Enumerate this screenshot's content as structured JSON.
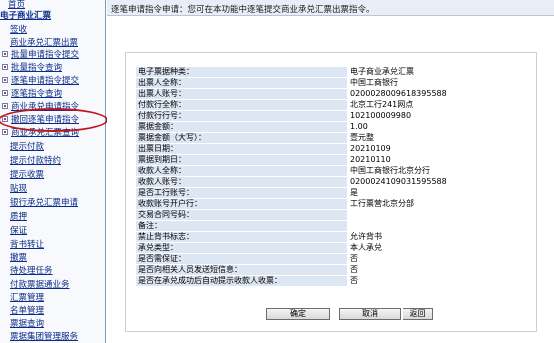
{
  "sidebar": {
    "items": [
      {
        "label": "首页",
        "kind": "plain"
      },
      {
        "label": "电子商业汇票",
        "kind": "section"
      },
      {
        "label": "签收",
        "kind": "plain"
      },
      {
        "label": "商业承兑汇票出票",
        "kind": "plain"
      },
      {
        "label": "批量申请指令提交",
        "kind": "bullet"
      },
      {
        "label": "批量指令查询",
        "kind": "bullet"
      },
      {
        "label": "逐笔申请指令提交",
        "kind": "bullet"
      },
      {
        "label": "逐笔指令查询",
        "kind": "bullet"
      },
      {
        "label": "商业承兑申请指令",
        "kind": "bullet"
      },
      {
        "label": "撤回逐笔申请指令",
        "kind": "bullet"
      },
      {
        "label": "商业承兑汇票查询",
        "kind": "bullet"
      },
      {
        "label": "提示付款",
        "kind": "plain"
      },
      {
        "label": "提示付款特约",
        "kind": "plain"
      },
      {
        "label": "提示收票",
        "kind": "plain"
      },
      {
        "label": "贴现",
        "kind": "plain"
      },
      {
        "label": "银行承兑汇票申请",
        "kind": "plain"
      },
      {
        "label": "质押",
        "kind": "plain"
      },
      {
        "label": "保证",
        "kind": "plain"
      },
      {
        "label": "背书转让",
        "kind": "plain"
      },
      {
        "label": "撤票",
        "kind": "plain"
      },
      {
        "label": "待处理任务",
        "kind": "plain"
      },
      {
        "label": "付款票据通业务",
        "kind": "plain"
      },
      {
        "label": "汇票管理",
        "kind": "plain"
      },
      {
        "label": "名单管理",
        "kind": "plain"
      },
      {
        "label": "票据查询",
        "kind": "plain"
      },
      {
        "label": "票据集团管理服务",
        "kind": "plain"
      }
    ]
  },
  "header": {
    "title": "逐笔申请指令申请：您可在本功能中逐笔提交商业承兑汇票出票指令。"
  },
  "form": {
    "rows": [
      {
        "label": "电子票据种类：",
        "value": "电子商业承兑汇票"
      },
      {
        "label": "出票人全称：",
        "value": "中国工商银行"
      },
      {
        "label": "出票人账号：",
        "value": "0200028009618395588"
      },
      {
        "label": "付款行全称：",
        "value": "北京工行241网点"
      },
      {
        "label": "付款行行号：",
        "value": "102100009980"
      },
      {
        "label": "票据金额：",
        "value": "1.00"
      },
      {
        "label": "票据金额（大写）：",
        "value": "壹元整"
      },
      {
        "label": "出票日期：",
        "value": "20210109"
      },
      {
        "label": "票据到期日：",
        "value": "20210110"
      },
      {
        "label": "收款人全称：",
        "value": "中国工商银行北京分行"
      },
      {
        "label": "收款人账号：",
        "value": "0200024109031595588"
      },
      {
        "label": "是否工行账号：",
        "value": "是"
      },
      {
        "label": "收款账号开户行：",
        "value": "工行票营北京分部"
      },
      {
        "label": "交易合同号码：",
        "value": ""
      },
      {
        "label": "备注：",
        "value": ""
      },
      {
        "label": "禁止背书标志：",
        "value": "允许背书"
      },
      {
        "label": "承兑类型：",
        "value": "本人承兑"
      },
      {
        "label": "是否需保证：",
        "value": "否"
      },
      {
        "label": "是否向相关人员发送短信息：",
        "value": "否"
      },
      {
        "label": "是否在承兑成功后自动提示收款人收票：",
        "value": "否"
      }
    ]
  },
  "buttons": {
    "confirm": "确定",
    "cancel": "取消",
    "back": "返回"
  },
  "colors": {
    "label_bg": "#dde7f4",
    "link": "#0b2c8a",
    "highlight_ring": "#c0171e"
  }
}
